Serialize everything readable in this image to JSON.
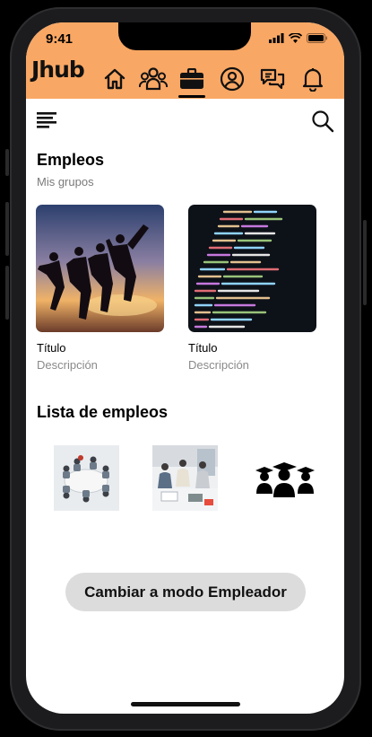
{
  "status_bar": {
    "time": "9:41"
  },
  "app": {
    "logo_text": "Jhub"
  },
  "nav": {
    "items": [
      {
        "icon": "home-icon"
      },
      {
        "icon": "groups-icon"
      },
      {
        "icon": "briefcase-icon",
        "active": true
      },
      {
        "icon": "profile-icon"
      },
      {
        "icon": "chat-icon"
      },
      {
        "icon": "bell-icon"
      }
    ]
  },
  "main": {
    "title": "Empleos",
    "subtitle": "Mis grupos",
    "cards": [
      {
        "title": "Título",
        "description": "Descripción",
        "image": "people-jumping-sunset-photo"
      },
      {
        "title": "Título",
        "description": "Descripción",
        "image": "code-screen-photo"
      }
    ],
    "list_title": "Lista de empleos",
    "list_items": [
      {
        "image": "office-meeting-photo"
      },
      {
        "image": "team-working-photo"
      },
      {
        "image": "graduates-icon"
      }
    ],
    "mode_button": "Cambiar a modo Empleador"
  },
  "colors": {
    "header": "#f9a764",
    "button_bg": "#dcdcdc"
  }
}
